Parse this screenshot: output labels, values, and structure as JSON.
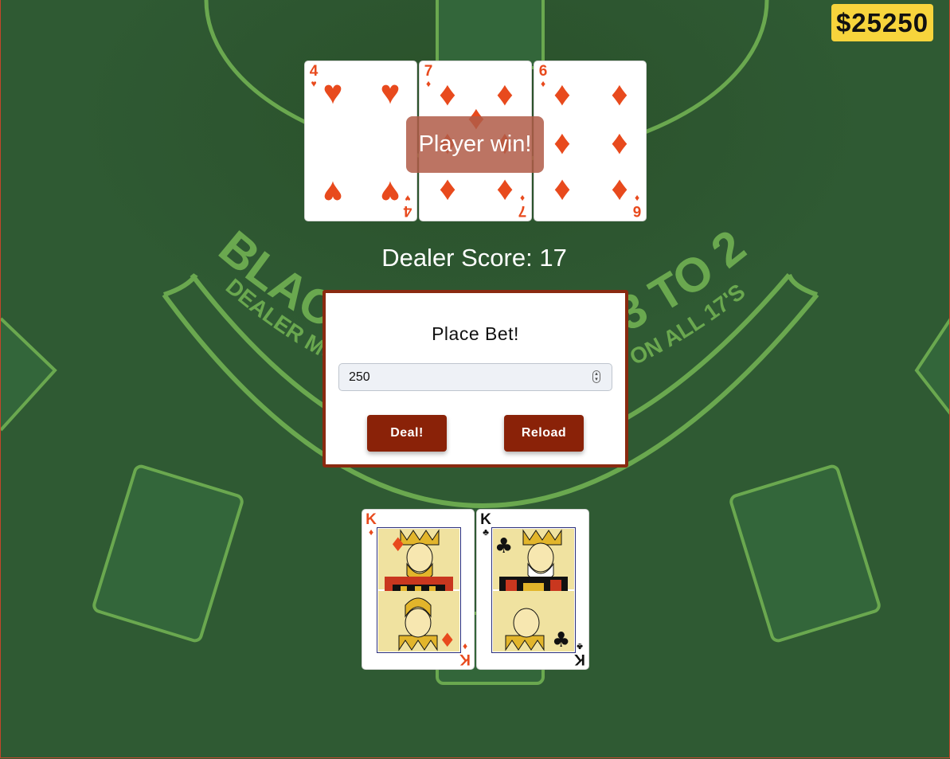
{
  "balance": "$25250",
  "result_message": "Player win!",
  "dealer_score_text": "Dealer Score: 17",
  "bet_panel": {
    "title": "Place Bet!",
    "bet_value": "250",
    "deal_label": "Deal!",
    "reload_label": "Reload"
  },
  "table_text": {
    "arc_main": "BLACKJACK PAYS 3 TO 2",
    "arc_sub": "DEALER MUST DRAW TO 16 AND STAND ON ALL 17'S"
  },
  "dealer_cards": [
    {
      "rank": "4",
      "suit": "♥",
      "color": "red"
    },
    {
      "rank": "7",
      "suit": "♦",
      "color": "red"
    },
    {
      "rank": "6",
      "suit": "♦",
      "color": "red"
    }
  ],
  "player_cards": [
    {
      "rank": "K",
      "suit": "♦",
      "color": "red"
    },
    {
      "rank": "K",
      "suit": "♣",
      "color": "black"
    }
  ],
  "colors": {
    "felt": "#2f5a33",
    "felt_lines": "#6aa84f",
    "button": "#8a2208",
    "balance_bg": "#f7d43c",
    "card_red": "#e84a1d"
  }
}
